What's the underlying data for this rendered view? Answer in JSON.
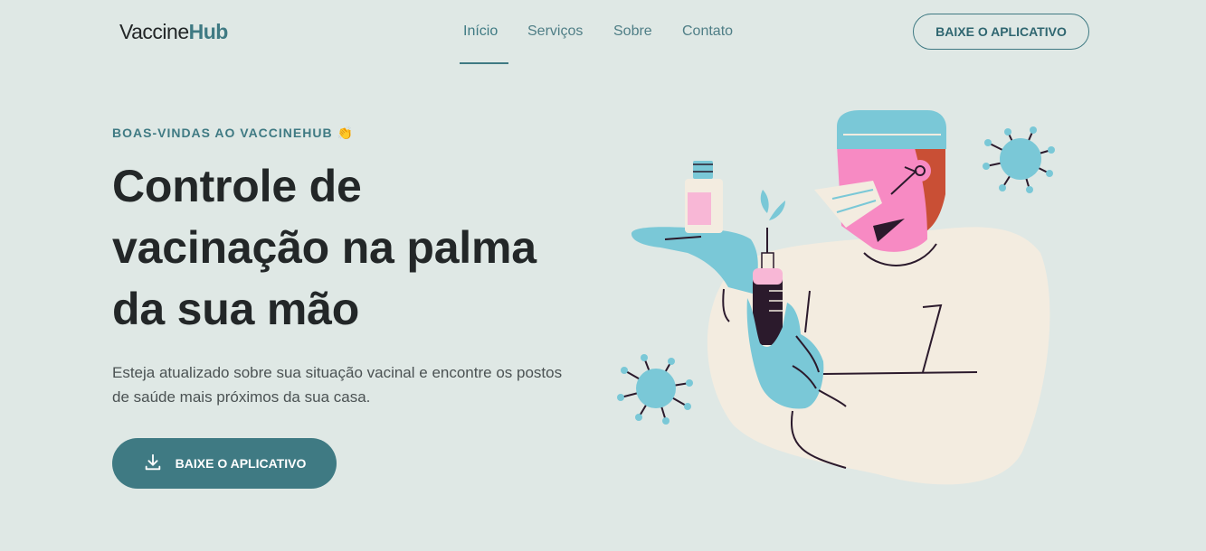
{
  "header": {
    "logo": {
      "part1": "Vaccine",
      "part2": "Hub"
    },
    "nav": [
      {
        "label": "Início",
        "active": true
      },
      {
        "label": "Serviços",
        "active": false
      },
      {
        "label": "Sobre",
        "active": false
      },
      {
        "label": "Contato",
        "active": false
      }
    ],
    "cta_label": "BAIXE O APLICATIVO"
  },
  "hero": {
    "eyebrow": "BOAS-VINDAS AO VACCINEHUB 👏",
    "headline_line1": "Controle de",
    "headline_line2": "vacinação na palma",
    "headline_line3": "da sua mão",
    "subtitle": "Esteja atualizado sobre sua situação vacinal e encontre os postos de saúde mais próximos da sua casa.",
    "cta_label": "BAIXE O APLICATIVO",
    "cta_icon": "download-icon"
  },
  "illustration": {
    "name": "nurse-with-vaccine-illustration",
    "icons": [
      "virus-icon",
      "virus-icon"
    ]
  },
  "colors": {
    "background": "#dfe8e5",
    "accent": "#3f7a83",
    "text": "#232728",
    "blue": "#7ac8d7",
    "pink": "#f78ac3",
    "cream": "#f3ece0",
    "red": "#c94f35"
  }
}
